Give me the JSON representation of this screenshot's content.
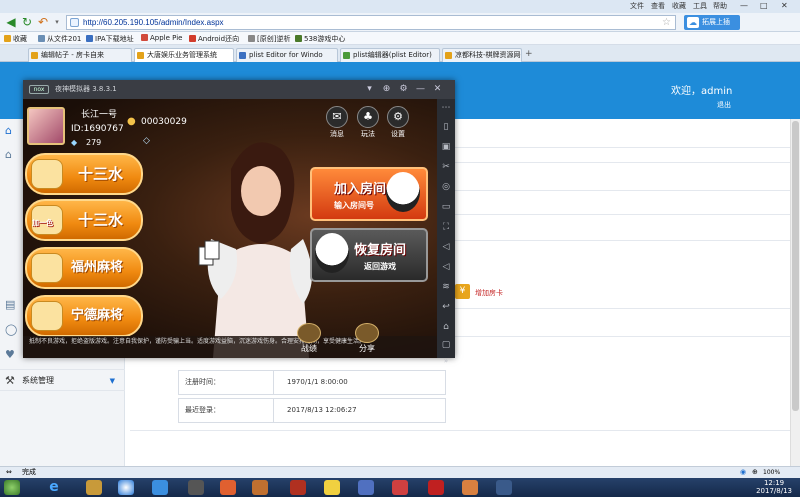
{
  "browser": {
    "menu": [
      "文件",
      "查看",
      "收藏",
      "工具",
      "帮助"
    ],
    "url": "http://60.205.190.105/admin/Index.aspx",
    "sync_label": "拓展上插",
    "favorites": [
      {
        "label": "收藏",
        "color": "#e3a21a"
      },
      {
        "label": "从文件201",
        "color": "#6b8fb5"
      },
      {
        "label": "IPA下载地址",
        "color": "#3a6fc1"
      },
      {
        "label": "Apple Pie",
        "color": "#d14a3b"
      },
      {
        "label": "Android还向",
        "color": "#d23c2c"
      },
      {
        "label": "[原创]逆析",
        "color": "#888888"
      },
      {
        "label": "538游戏中心",
        "color": "#4a7a2a"
      }
    ],
    "tabs": [
      {
        "label": "编辑帖子 - 房卡自来",
        "color": "#e3a21a"
      },
      {
        "label": "大唐娱乐业务管理系统",
        "color": "#e3a21a"
      },
      {
        "label": "plist Editor for Windo",
        "color": "#3a6fc1"
      },
      {
        "label": "plist编辑器(plist Editor)",
        "color": "#4a9a3a"
      },
      {
        "label": "凉都科技-棋牌资源网-",
        "color": "#e3a21a"
      }
    ],
    "status": "完成",
    "zoom": "100%"
  },
  "admin": {
    "welcome": "欢迎，admin",
    "logout": "退出",
    "sidebar_section": "系统管理",
    "add_card": "增加房卡",
    "fields": [
      {
        "label": "注册时间：",
        "value": "1970/1/1 8:00:00"
      },
      {
        "label": "最近登录：",
        "value": "2017/8/13 12:06:27"
      }
    ]
  },
  "nox": {
    "title": "夜神模拟器 3.8.3.1",
    "logo": "nox",
    "player": {
      "name": "长江一号",
      "id": "ID:1690767",
      "diamonds": "279",
      "coins": "00030029"
    },
    "top_icons": [
      "消息",
      "玩法",
      "设置"
    ],
    "games": [
      {
        "label": "十三水",
        "sub": ""
      },
      {
        "label": "十三水",
        "sub": "加一色"
      },
      {
        "label": "福州麻将",
        "sub": ""
      },
      {
        "label": "宁德麻将",
        "sub": ""
      }
    ],
    "join": {
      "title": "加入房间",
      "sub": "输入房间号"
    },
    "restore": {
      "title": "恢复房间",
      "sub": "返回游戏"
    },
    "notice": "抵制不良游戏，拒绝盗版游戏。注意自我保护，谨防受骗上当。适度游戏益脑，沉迷游戏伤身。合理安排时间，享受健康生活。",
    "bottom": [
      "战绩",
      "分享"
    ]
  },
  "taskbar": {
    "time": "12:19",
    "date": "2017/8/13"
  }
}
